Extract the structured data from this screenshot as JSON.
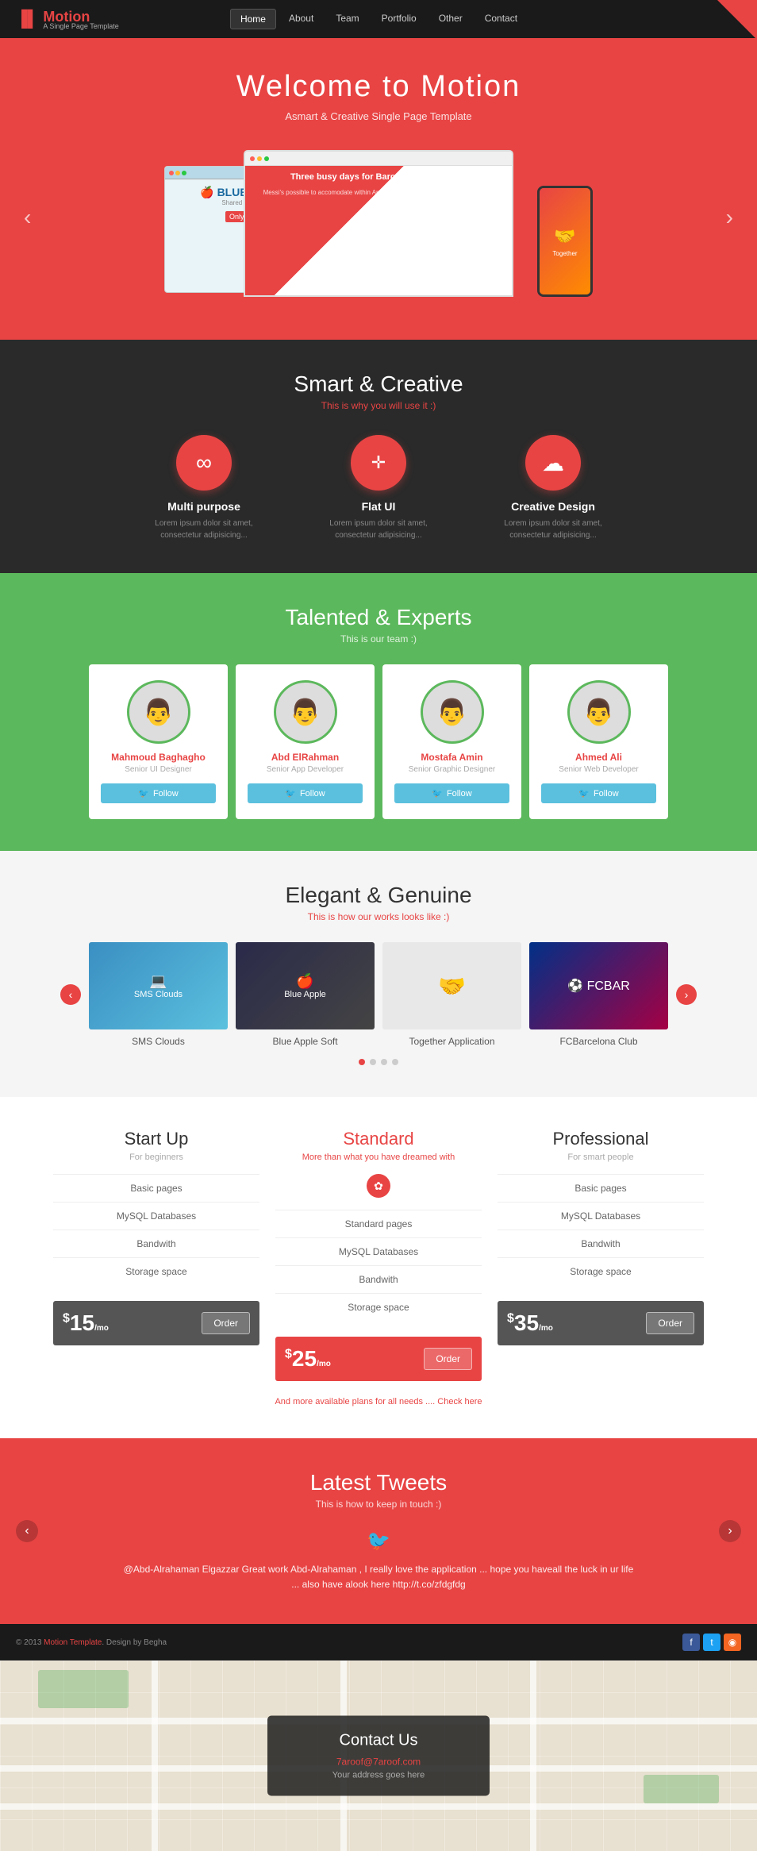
{
  "navbar": {
    "brand": "Motion",
    "brand_sub": "A Single Page Template",
    "nav_items": [
      "Home",
      "About",
      "Team",
      "Portfolio",
      "Other",
      "Contact"
    ],
    "active_nav": "Home"
  },
  "hero": {
    "title": "Welcome to Motion",
    "subtitle": "Asmart & Creative Single Page Template",
    "left_arrow": "‹",
    "right_arrow": "›"
  },
  "features": {
    "title": "Smart & Creative",
    "subtitle": "This is why you will use it :)",
    "items": [
      {
        "icon": "∞",
        "title": "Multi purpose",
        "desc": "Lorem ipsum dolor sit amet, consectetur adipisicing..."
      },
      {
        "icon": "✛",
        "title": "Flat UI",
        "desc": "Lorem ipsum dolor sit amet, consectetur adipisicing..."
      },
      {
        "icon": "☁",
        "title": "Creative Design",
        "desc": "Lorem ipsum dolor sit amet, consectetur adipisicing..."
      }
    ]
  },
  "team": {
    "title": "Talented & Experts",
    "subtitle": "This is our team :)",
    "members": [
      {
        "name": "Mahmoud Baghagho",
        "role": "Senior UI Designer",
        "avatar": "👨"
      },
      {
        "name": "Abd ElRahman",
        "role": "Senior App Developer",
        "avatar": "👨"
      },
      {
        "name": "Mostafa Amin",
        "role": "Senior Graphic Designer",
        "avatar": "👨"
      },
      {
        "name": "Ahmed Ali",
        "role": "Senior Web Developer",
        "avatar": "👨"
      }
    ],
    "follow_label": "Follow"
  },
  "portfolio": {
    "title": "Elegant & Genuine",
    "subtitle": "This is how our works looks like :)",
    "items": [
      {
        "label": "SMS Clouds",
        "color": "#3a8fc2"
      },
      {
        "label": "Blue Apple Soft",
        "color": "#2a2a4a"
      },
      {
        "label": "Together Application",
        "color": "#f0f0f0"
      },
      {
        "label": "FCBarcelona Club",
        "color": "#003087"
      }
    ],
    "left_arrow": "‹",
    "right_arrow": "›"
  },
  "pricing": {
    "plans": [
      {
        "title": "Start Up",
        "subtitle": "For beginners",
        "featured": false,
        "features": [
          "Basic pages",
          "MySQL Databases",
          "Bandwith",
          "Storage space"
        ],
        "price": "15",
        "period": "/mo",
        "order": "Order"
      },
      {
        "title": "Standard",
        "subtitle": "More than what you have dreamed with",
        "featured": true,
        "features": [
          "Standard pages",
          "MySQL Databases",
          "Bandwith",
          "Storage space"
        ],
        "price": "25",
        "period": "/mo",
        "order": "Order"
      },
      {
        "title": "Professional",
        "subtitle": "For smart people",
        "featured": false,
        "features": [
          "Basic pages",
          "MySQL Databases",
          "Bandwith",
          "Storage space"
        ],
        "price": "35",
        "period": "/mo",
        "order": "Order"
      }
    ],
    "note": "And more available plans for all needs .... Check here"
  },
  "tweets": {
    "title": "Latest Tweets",
    "subtitle": "This is how to keep in touch :)",
    "tweet": "@Abd-Alrahaman Elgazzar Great work Abd-Alrahaman , I really love the application ... hope you haveall the luck in ur life ... also have alook here http://t.co/zfdgfdg",
    "left_arrow": "‹",
    "right_arrow": "›"
  },
  "footer": {
    "text": "© 2013 Motion Template. Design by Begha",
    "brand_link": "Motion Template"
  },
  "contact": {
    "title": "Contact Us",
    "email": "7aroof@7aroof.com",
    "address": "Your address goes here"
  }
}
